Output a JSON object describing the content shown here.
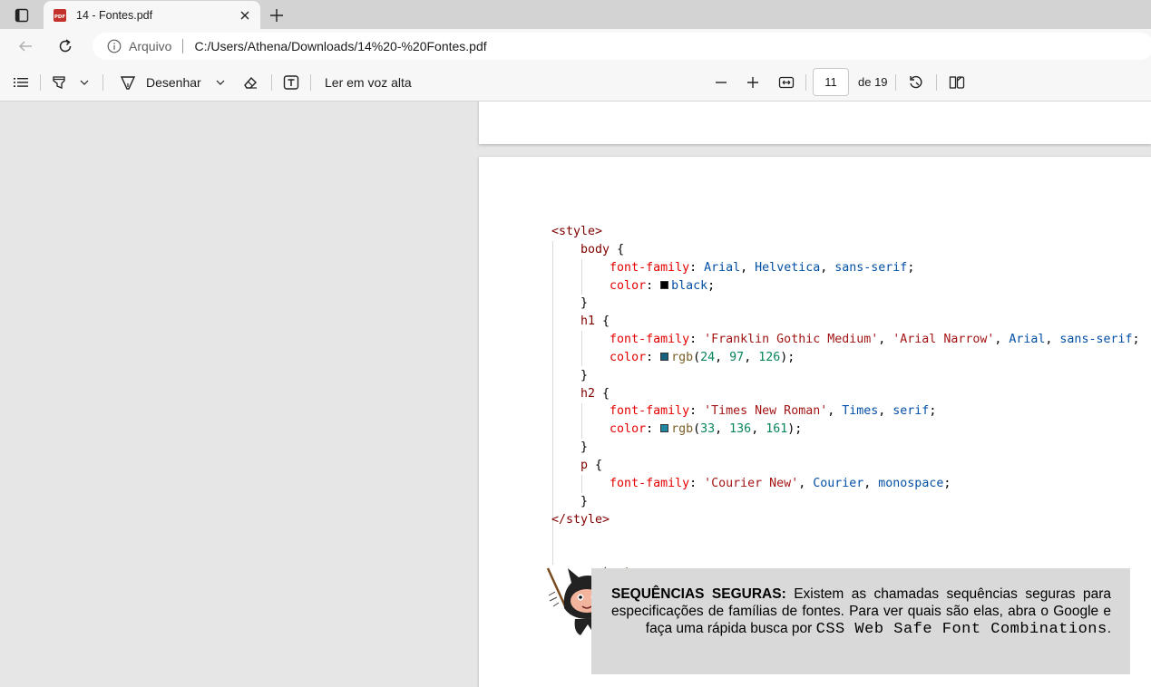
{
  "browser": {
    "tab": {
      "title": "14 - Fontes.pdf"
    },
    "address": {
      "site_label": "Arquivo",
      "url": "C:/Users/Athena/Downloads/14%20-%20Fontes.pdf"
    }
  },
  "pdf_toolbar": {
    "draw_label": "Desenhar",
    "read_aloud_label": "Ler em voz alta",
    "current_page": "11",
    "page_of": "de 19"
  },
  "document": {
    "code_lines": [
      [
        {
          "t": "<style>",
          "c": "tag"
        }
      ],
      [
        {
          "t": "    "
        },
        {
          "t": "body",
          "c": "sel"
        },
        {
          "t": " {",
          "c": "brace"
        }
      ],
      [
        {
          "t": "        "
        },
        {
          "t": "font-family",
          "c": "prop"
        },
        {
          "t": ": ",
          "c": "punc"
        },
        {
          "t": "Arial",
          "c": "val"
        },
        {
          "t": ", ",
          "c": "punc"
        },
        {
          "t": "Helvetica",
          "c": "val"
        },
        {
          "t": ", ",
          "c": "punc"
        },
        {
          "t": "sans-serif",
          "c": "val"
        },
        {
          "t": ";",
          "c": "punc"
        }
      ],
      [
        {
          "t": "        "
        },
        {
          "t": "color",
          "c": "prop"
        },
        {
          "t": ": ",
          "c": "punc"
        },
        {
          "swatch": "#000000"
        },
        {
          "t": "black",
          "c": "val"
        },
        {
          "t": ";",
          "c": "punc"
        }
      ],
      [
        {
          "t": "    "
        },
        {
          "t": "}",
          "c": "brace"
        }
      ],
      [
        {
          "t": "    "
        },
        {
          "t": "h1",
          "c": "sel"
        },
        {
          "t": " {",
          "c": "brace"
        }
      ],
      [
        {
          "t": "        "
        },
        {
          "t": "font-family",
          "c": "prop"
        },
        {
          "t": ": ",
          "c": "punc"
        },
        {
          "t": "'Franklin Gothic Medium'",
          "c": "str"
        },
        {
          "t": ", ",
          "c": "punc"
        },
        {
          "t": "'Arial Narrow'",
          "c": "str"
        },
        {
          "t": ", ",
          "c": "punc"
        },
        {
          "t": "Arial",
          "c": "val"
        },
        {
          "t": ", ",
          "c": "punc"
        },
        {
          "t": "sans-serif",
          "c": "val"
        },
        {
          "t": ";",
          "c": "punc"
        }
      ],
      [
        {
          "t": "        "
        },
        {
          "t": "color",
          "c": "prop"
        },
        {
          "t": ": ",
          "c": "punc"
        },
        {
          "swatch": "#18617e"
        },
        {
          "t": "rgb",
          "c": "fn"
        },
        {
          "t": "(",
          "c": "punc"
        },
        {
          "t": "24",
          "c": "num"
        },
        {
          "t": ", ",
          "c": "punc"
        },
        {
          "t": "97",
          "c": "num"
        },
        {
          "t": ", ",
          "c": "punc"
        },
        {
          "t": "126",
          "c": "num"
        },
        {
          "t": ");",
          "c": "punc"
        }
      ],
      [
        {
          "t": "    "
        },
        {
          "t": "}",
          "c": "brace"
        }
      ],
      [
        {
          "t": "    "
        },
        {
          "t": "h2",
          "c": "sel"
        },
        {
          "t": " {",
          "c": "brace"
        }
      ],
      [
        {
          "t": "        "
        },
        {
          "t": "font-family",
          "c": "prop"
        },
        {
          "t": ": ",
          "c": "punc"
        },
        {
          "t": "'Times New Roman'",
          "c": "str"
        },
        {
          "t": ", ",
          "c": "punc"
        },
        {
          "t": "Times",
          "c": "val"
        },
        {
          "t": ", ",
          "c": "punc"
        },
        {
          "t": "serif",
          "c": "val"
        },
        {
          "t": ";",
          "c": "punc"
        }
      ],
      [
        {
          "t": "        "
        },
        {
          "t": "color",
          "c": "prop"
        },
        {
          "t": ": ",
          "c": "punc"
        },
        {
          "swatch": "#2188a1"
        },
        {
          "t": "rgb",
          "c": "fn"
        },
        {
          "t": "(",
          "c": "punc"
        },
        {
          "t": "33",
          "c": "num"
        },
        {
          "t": ", ",
          "c": "punc"
        },
        {
          "t": "136",
          "c": "num"
        },
        {
          "t": ", ",
          "c": "punc"
        },
        {
          "t": "161",
          "c": "num"
        },
        {
          "t": ");",
          "c": "punc"
        }
      ],
      [
        {
          "t": "    "
        },
        {
          "t": "}",
          "c": "brace"
        }
      ],
      [
        {
          "t": "    "
        },
        {
          "t": "p",
          "c": "sel"
        },
        {
          "t": " {",
          "c": "brace"
        }
      ],
      [
        {
          "t": "        "
        },
        {
          "t": "font-family",
          "c": "prop"
        },
        {
          "t": ": ",
          "c": "punc"
        },
        {
          "t": "'Courier New'",
          "c": "str"
        },
        {
          "t": ", ",
          "c": "punc"
        },
        {
          "t": "Courier",
          "c": "val"
        },
        {
          "t": ", ",
          "c": "punc"
        },
        {
          "t": "monospace",
          "c": "val"
        },
        {
          "t": ";",
          "c": "punc"
        }
      ],
      [
        {
          "t": "    "
        },
        {
          "t": "}",
          "c": "brace"
        }
      ],
      [
        {
          "t": "</style>",
          "c": "tag"
        }
      ]
    ],
    "tip": {
      "heading": "SEQUÊNCIAS SEGURAS:",
      "body": " Existem as chamadas sequências seguras para especificações de famílias de fontes. Para ver quais são elas, abra o Google e faça uma rápida busca por ",
      "query": "CSS Web Safe Font Combinations",
      "end": "."
    }
  },
  "icons": [
    "sidebar-toggle-icon",
    "pdf-file-icon",
    "close-icon",
    "plus-icon",
    "back-arrow-icon",
    "refresh-icon",
    "info-icon",
    "contents-list-icon",
    "highlighter-icon",
    "chevron-down-icon",
    "draw-pen-icon",
    "eraser-icon",
    "text-box-icon",
    "zoom-out-icon",
    "zoom-in-icon",
    "fit-width-icon",
    "rotate-icon",
    "page-view-icon",
    "cat-mascot-icon"
  ]
}
